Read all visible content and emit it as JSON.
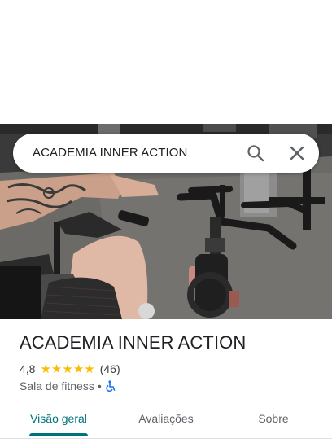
{
  "search": {
    "query": "ACADEMIA INNER ACTION"
  },
  "place": {
    "name": "ACADEMIA INNER ACTION",
    "rating": "4,8",
    "rating_stars": 5,
    "review_count": "(46)",
    "category": "Sala de fitness",
    "separator": "•"
  },
  "tabs": [
    {
      "label": "Visão geral",
      "active": true
    },
    {
      "label": "Avaliações",
      "active": false
    },
    {
      "label": "Sobre",
      "active": false
    }
  ],
  "colors": {
    "accent": "#00737a",
    "star": "#fbbc04",
    "accessibility": "#1a73e8"
  },
  "icons": {
    "search": "search-icon",
    "close": "close-icon",
    "accessibility": "wheelchair-icon"
  }
}
